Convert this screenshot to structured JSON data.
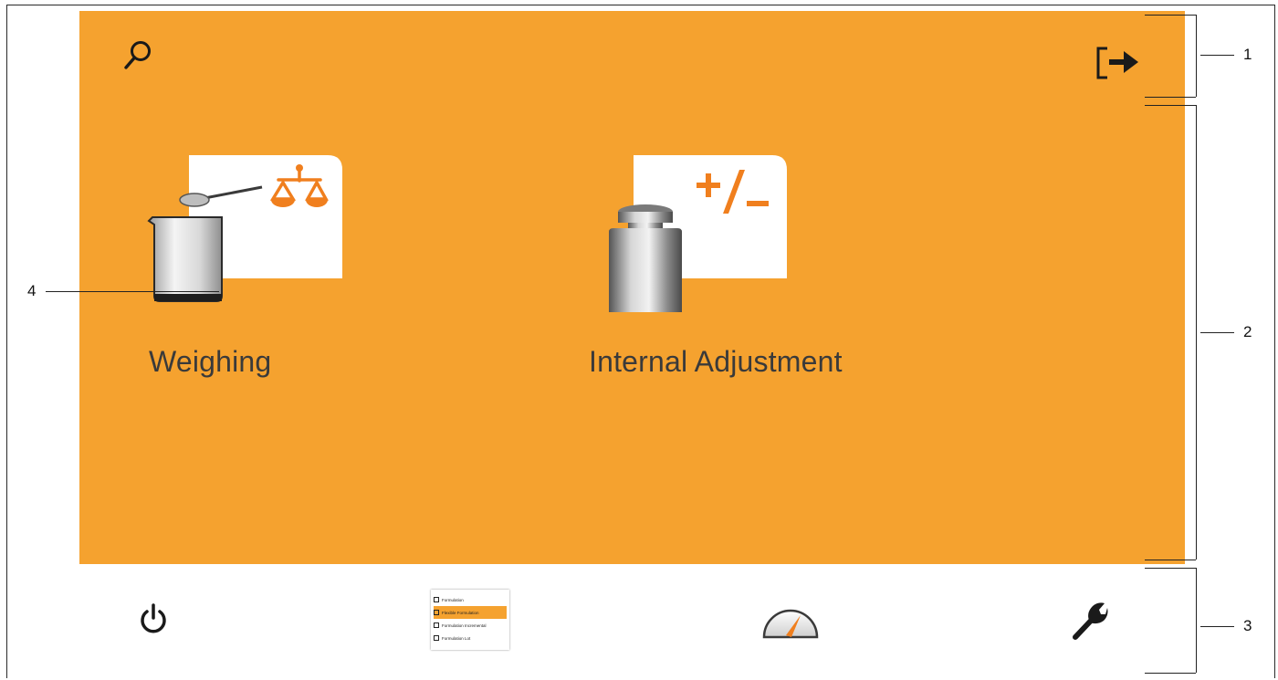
{
  "header": {
    "search_icon": "search-icon",
    "logout_icon": "logout-icon"
  },
  "apps": [
    {
      "label": "Weighing",
      "icon": "weighing-app-icon"
    },
    {
      "label": "Internal Adjustment",
      "icon": "internal-adjustment-app-icon"
    }
  ],
  "bottom_bar": {
    "power_icon": "power-icon",
    "task_list_icon": "task-list-icon",
    "task_list_preview": [
      "Formulation",
      "Flexible Formulation",
      "Formulation Incremental",
      "Formulation Lot"
    ],
    "gauge_icon": "gauge-icon",
    "settings_icon": "wrench-icon"
  },
  "callouts": [
    "1",
    "2",
    "3",
    "4"
  ],
  "colors": {
    "accent": "#f5a22f",
    "text": "#3a3a3a",
    "icon_orange": "#f07f1e"
  }
}
